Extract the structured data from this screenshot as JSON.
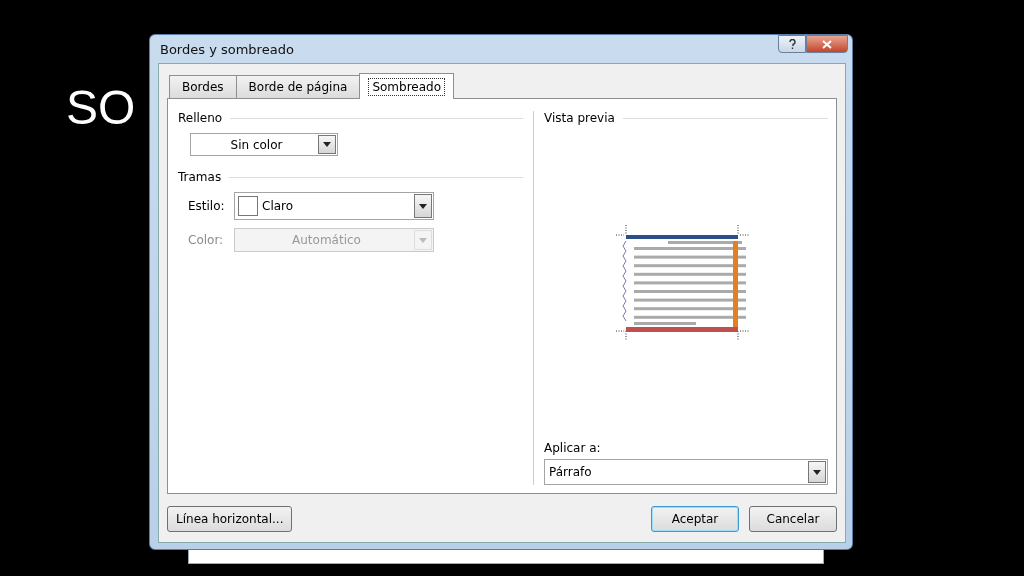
{
  "slide": {
    "title": "SO"
  },
  "window": {
    "title": "Bordes y sombreado"
  },
  "tabs": [
    {
      "label": "Bordes",
      "selected": false
    },
    {
      "label": "Borde de página",
      "selected": false
    },
    {
      "label": "Sombreado",
      "selected": true
    }
  ],
  "fill": {
    "heading": "Relleno",
    "value": "Sin color"
  },
  "patterns": {
    "heading": "Tramas",
    "fields": [
      {
        "label": "Estilo:",
        "value": "Claro",
        "disabled": false,
        "swatch": true
      },
      {
        "label": "Color:",
        "value": "Automático",
        "disabled": true,
        "swatch": false
      }
    ]
  },
  "preview": {
    "heading": "Vista previa",
    "apply_label": "Aplicar a:",
    "apply_value": "Párrafo"
  },
  "buttons": [
    {
      "label": "Línea horizontal...",
      "default": false
    },
    {
      "label": "Aceptar",
      "default": true
    },
    {
      "label": "Cancelar",
      "default": false
    }
  ]
}
